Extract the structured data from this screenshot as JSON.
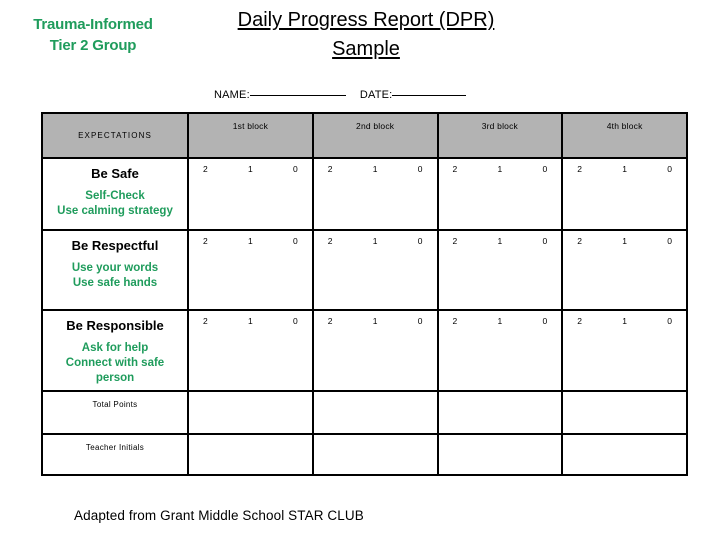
{
  "header": {
    "program_label_line1": "Trauma-Informed",
    "program_label_line2": "Tier 2 Group",
    "title_line1": "Daily Progress Report (DPR)",
    "title_line2": "Sample",
    "accent_color": "#1f9c5c"
  },
  "form_fields": {
    "name_label": "NAME:",
    "date_label": "DATE:",
    "name_value": "",
    "date_value": ""
  },
  "table": {
    "header_bg": "#b3b3b3",
    "row_bg": "#e0e0e0",
    "columns": [
      {
        "key": "expectations",
        "label": "EXPECTATIONS"
      },
      {
        "key": "block1",
        "label": "1st block"
      },
      {
        "key": "block2",
        "label": "2nd block"
      },
      {
        "key": "block3",
        "label": "3rd block"
      },
      {
        "key": "block4",
        "label": "4th block"
      }
    ],
    "scale": [
      "2",
      "1",
      "0"
    ],
    "rows": [
      {
        "title": "Be Safe",
        "sub_lines": [
          "Self-Check",
          "Use calming strategy"
        ]
      },
      {
        "title": "Be Respectful",
        "sub_lines": [
          "Use your words",
          "Use safe hands"
        ]
      },
      {
        "title": "Be Responsible",
        "sub_lines": [
          "Ask for help",
          "Connect with safe",
          "person"
        ]
      }
    ],
    "summary_rows": [
      {
        "label": "Total Points"
      },
      {
        "label": "Teacher Initials"
      }
    ]
  },
  "footer": {
    "credit": "Adapted from Grant Middle School STAR CLUB"
  }
}
